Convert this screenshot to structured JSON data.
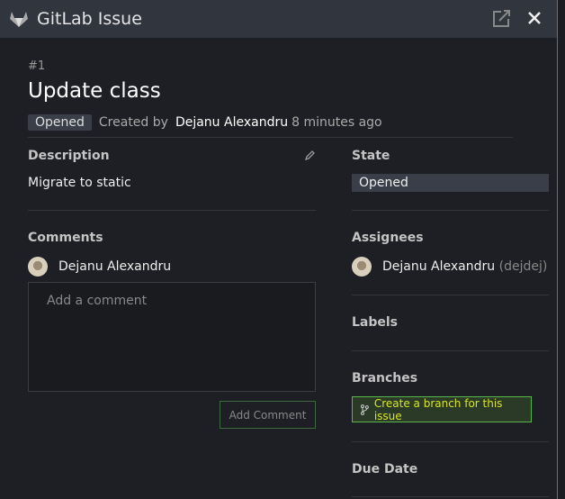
{
  "window": {
    "title": "GitLab Issue"
  },
  "issue": {
    "number": "#1",
    "title": "Update class",
    "status": "Opened",
    "created_prefix": "Created by",
    "author": "Dejanu Alexandru",
    "time": "8 minutes ago"
  },
  "description": {
    "label": "Description",
    "text": "Migrate to static"
  },
  "comments": {
    "label": "Comments",
    "user": "Dejanu Alexandru",
    "placeholder": "Add a comment",
    "button": "Add Comment"
  },
  "sidebar": {
    "state_label": "State",
    "state_value": "Opened",
    "assignees_label": "Assignees",
    "assignee": "Dejanu Alexandru",
    "assignee_handle": "(dejdej)",
    "labels_label": "Labels",
    "branches_label": "Branches",
    "branch_button": "Create a branch for this issue",
    "due_label": "Due Date"
  },
  "colors": {
    "accent": "#2a7bd6",
    "branch_border": "#58b84a",
    "branch_text": "#d7e620"
  }
}
